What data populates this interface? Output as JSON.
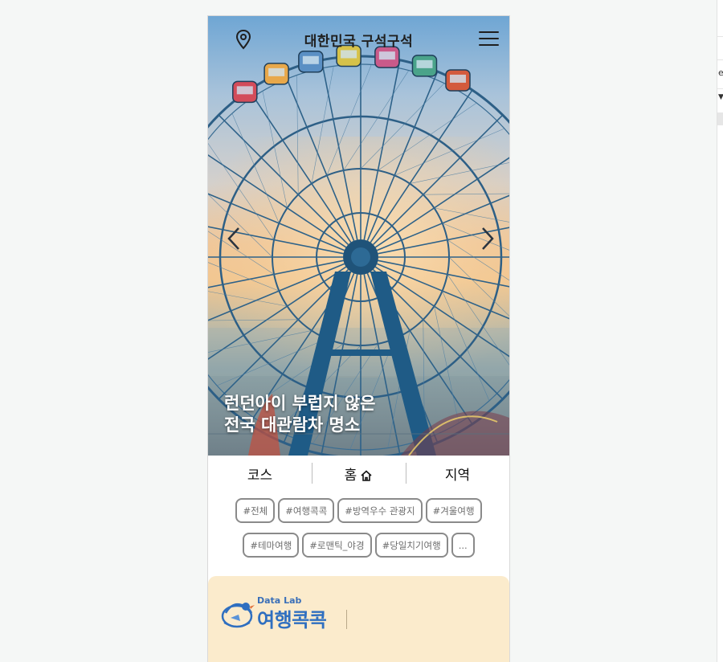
{
  "header": {
    "title": "대한민국 구석구석",
    "location_icon": "map-pin-icon",
    "menu_icon": "hamburger-menu-icon"
  },
  "hero": {
    "caption_line1": "런던아이 부럽지 않은",
    "caption_line2": "전국 대관람차 명소",
    "prev_icon": "chevron-left-icon",
    "next_icon": "chevron-right-icon"
  },
  "tabs": [
    {
      "label": "코스"
    },
    {
      "label": "홈",
      "icon": "home-icon"
    },
    {
      "label": "지역"
    }
  ],
  "hashtags_row1": [
    "#전체",
    "#여행콕콕",
    "#방역우수 관광지",
    "#겨울여행"
  ],
  "hashtags_row2": [
    "#테마여행",
    "#로맨틱_야경",
    "#당일치기여행",
    "..."
  ],
  "banner": {
    "sub": "Data Lab",
    "title": "여행콕콕",
    "background": "#fbebcc",
    "accent": "#2f6fc0"
  }
}
